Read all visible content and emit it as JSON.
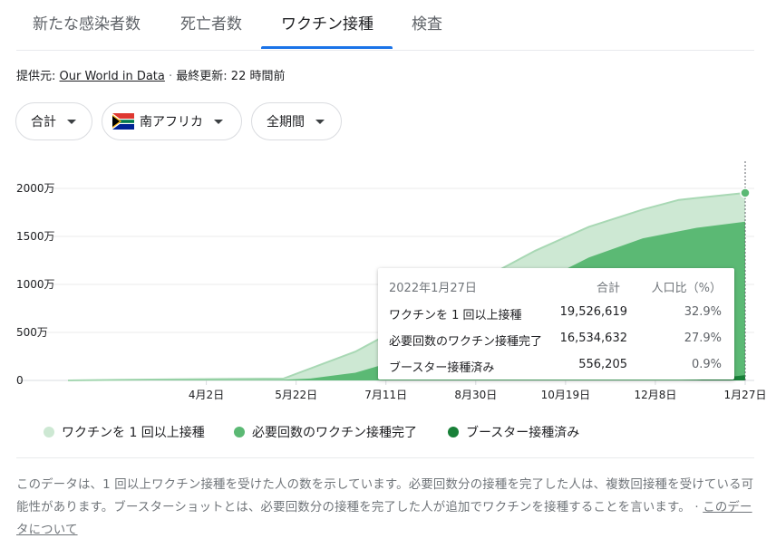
{
  "tabs": [
    {
      "label": "新たな感染者数"
    },
    {
      "label": "死亡者数"
    },
    {
      "label": "ワクチン接種"
    },
    {
      "label": "検査"
    }
  ],
  "source": {
    "prefix": "提供元: ",
    "provider": "Our World in Data",
    "separator": " · ",
    "updated": "最終更新: 22 時間前"
  },
  "filters": {
    "metric": "合計",
    "region": "南アフリカ",
    "period": "全期間"
  },
  "colors": {
    "first_dose": "#cde8d3",
    "first_dose_line": "#a8d8b4",
    "fully_vaccinated": "#5bb974",
    "booster": "#188038",
    "tab_accent": "#1a73e8"
  },
  "chart_data": {
    "type": "area",
    "ylim": [
      0,
      2000
    ],
    "yticks": [
      0,
      500,
      1000,
      1500,
      2000
    ],
    "ytick_labels": [
      "0",
      "500万",
      "1000万",
      "1500万",
      "2000万"
    ],
    "xtick_labels": [
      "4月2日",
      "5月22日",
      "7月11日",
      "8月30日",
      "10月19日",
      "12月8日",
      "1月27日"
    ],
    "xtick_days": [
      77,
      127,
      177,
      227,
      277,
      327,
      377
    ],
    "xlim": [
      0,
      377
    ],
    "series": [
      {
        "name": "ワクチンを 1 回以上接種",
        "days": [
          0,
          60,
          120,
          160,
          200,
          230,
          260,
          290,
          320,
          340,
          360,
          377
        ],
        "values": [
          0,
          12,
          20,
          300,
          700,
          1050,
          1350,
          1600,
          1780,
          1880,
          1920,
          1953
        ]
      },
      {
        "name": "必要回数のワクチン接種完了",
        "days": [
          0,
          60,
          120,
          135,
          160,
          200,
          230,
          260,
          290,
          320,
          350,
          377
        ],
        "values": [
          0,
          5,
          8,
          20,
          80,
          300,
          650,
          1000,
          1280,
          1480,
          1590,
          1653
        ]
      },
      {
        "name": "ブースター接種済み",
        "days": [
          0,
          340,
          350,
          360,
          370,
          377
        ],
        "values": [
          0,
          0,
          5,
          20,
          40,
          56
        ]
      }
    ],
    "tooltip": {
      "date": "2022年1月27日",
      "col_total": "合計",
      "col_ratio": "人口比（%）",
      "rows": [
        {
          "label": "ワクチンを 1 回以上接種",
          "total": "19,526,619",
          "ratio": "32.9%"
        },
        {
          "label": "必要回数のワクチン接種完了",
          "total": "16,534,632",
          "ratio": "27.9%"
        },
        {
          "label": "ブースター接種済み",
          "total": "556,205",
          "ratio": "0.9%"
        }
      ]
    }
  },
  "legend": [
    {
      "label": "ワクチンを 1 回以上接種"
    },
    {
      "label": "必要回数のワクチン接種完了"
    },
    {
      "label": "ブースター接種済み"
    }
  ],
  "footnote": {
    "text": "このデータは、1 回以上ワクチン接種を受けた人の数を示しています。必要回数分の接種を完了した人は、複数回接種を受けている可能性があります。ブースターショットとは、必要回数分の接種を完了した人が追加でワクチンを接種することを言います。",
    "sep": " · ",
    "link": "このデータについて"
  }
}
